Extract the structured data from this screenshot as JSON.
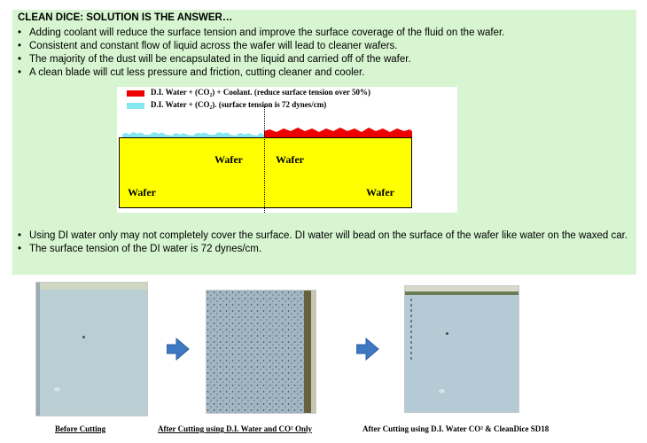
{
  "heading": "CLEAN DICE: SOLUTION IS THE ANSWER…",
  "bullets_top": [
    "Adding coolant will reduce the surface tension and improve the surface coverage of the fluid on the wafer.",
    "Consistent and constant flow of liquid across the wafer will lead to cleaner wafers.",
    "The majority of the dust will be encapsulated in the liquid and carried off of the wafer.",
    "A clean blade will  cut less pressure and friction,    cutting cleaner and cooler."
  ],
  "diagram": {
    "legend_red": "D.I. Water + (CO₂) + Coolant. (reduce surface tension over 50%)",
    "legend_blue": "D.I. Water + (CO₂). (surface tension is 72 dynes/cm)",
    "wafer_label_1": "Wafer",
    "wafer_label_2": "Wafer",
    "wafer_label_3": "Wafer",
    "wafer_label_4": "Wafer",
    "colors": {
      "coolant": "#ee0000",
      "di_water": "#88e8f2",
      "wafer": "#ffff00"
    }
  },
  "bullets_bottom": [
    "Using DI water only may not completely cover the surface. DI water will bead on the surface of the wafer like water on the waxed car.",
    "The surface tension of the DI water is 72 dynes/cm."
  ],
  "photos": {
    "caption_1": "Before Cutting",
    "caption_2": "After Cutting using D.I. Water and CO² Only",
    "caption_3": "After Cutting using D.I. Water CO² & CleanDice SD18"
  }
}
